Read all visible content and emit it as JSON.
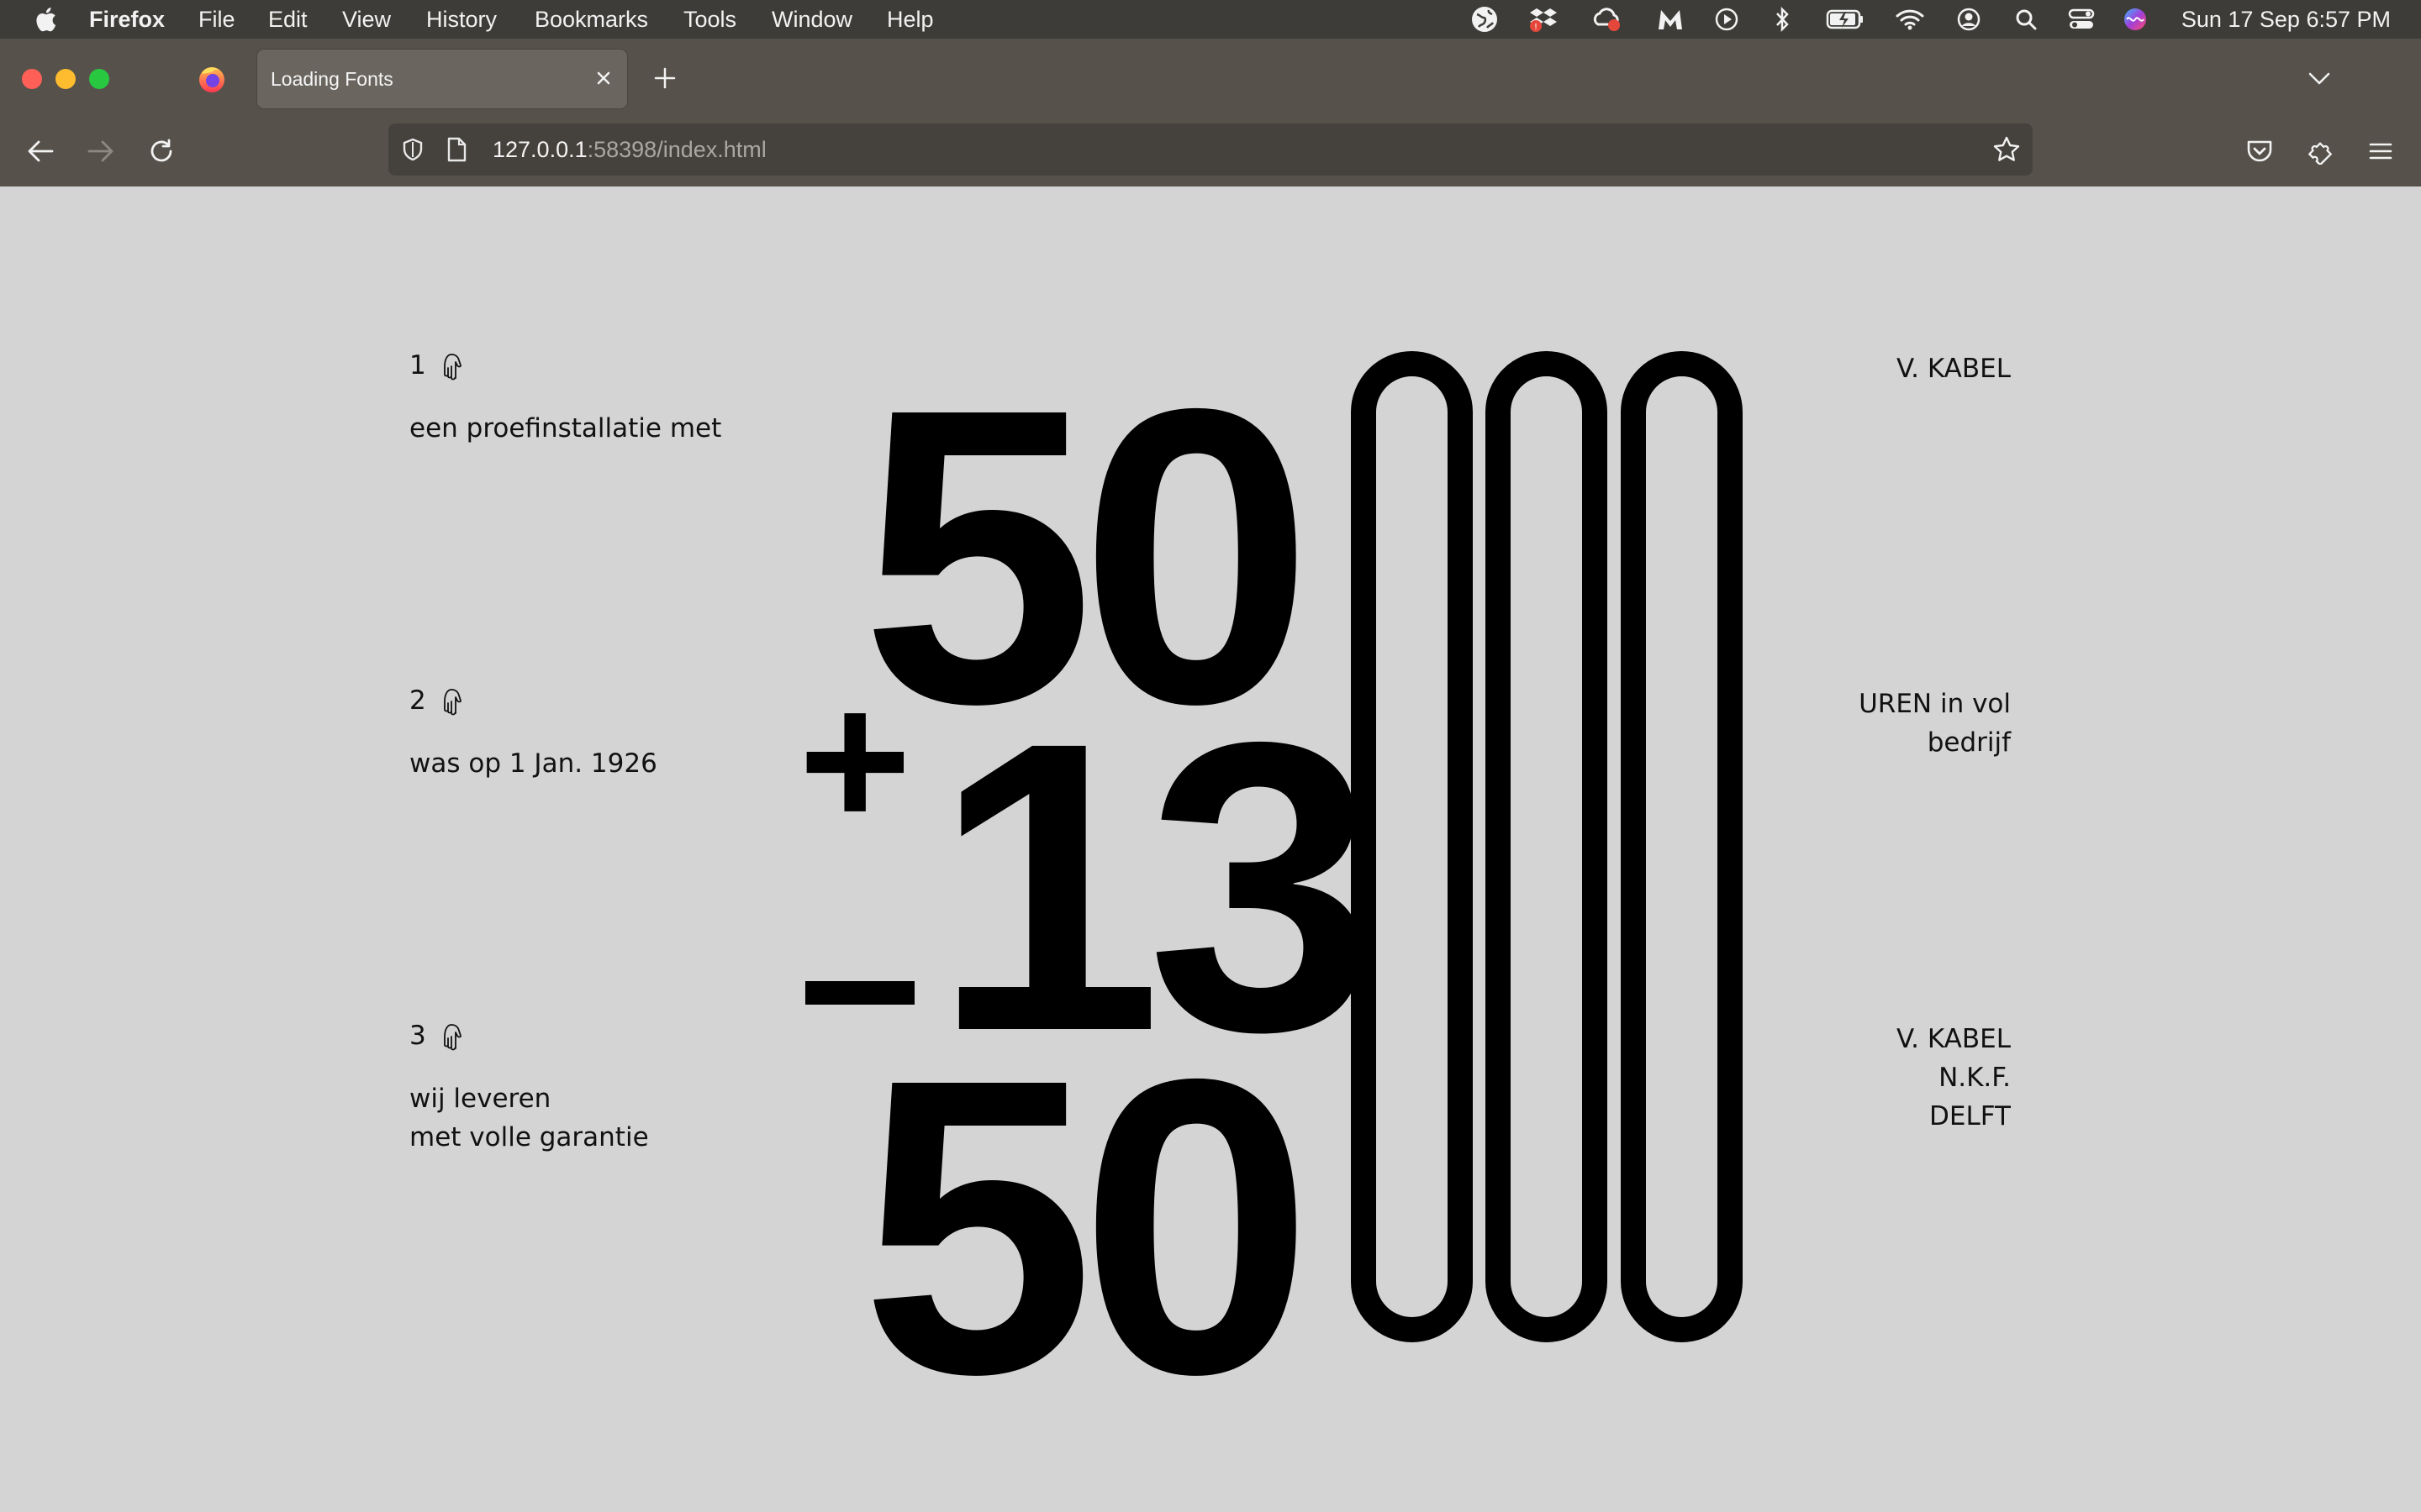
{
  "menubar": {
    "app_name": "Firefox",
    "items": [
      "File",
      "Edit",
      "View",
      "History",
      "Bookmarks",
      "Tools",
      "Window",
      "Help"
    ],
    "clock": "Sun 17 Sep  6:57 PM"
  },
  "browser": {
    "tab_title": "Loading Fonts",
    "url_host": "127.0.0.1",
    "url_rest": ":58398/index.html"
  },
  "page": {
    "rows": [
      {
        "number": "1",
        "left_lines": [
          "een proefinstallatie met"
        ],
        "right_lines": [
          "V. KABEL"
        ]
      },
      {
        "number": "2",
        "left_lines": [
          "was op 1 Jan. 1926"
        ],
        "right_lines": [
          "UREN in vol",
          "bedrijf"
        ]
      },
      {
        "number": "3",
        "left_lines": [
          "wij leveren",
          "met volle garantie"
        ],
        "right_lines": [
          "V. KABEL",
          "N.K.F.",
          "DELFT"
        ]
      }
    ],
    "big": {
      "top": "50",
      "middle": "13",
      "bottom": "50",
      "plus": "+",
      "minus": "−"
    }
  },
  "icons": [
    "apple-icon",
    "globe-icon",
    "dropbox-icon",
    "creative-cloud-icon",
    "malwarebytes-icon",
    "play-icon",
    "bluetooth-icon",
    "battery-icon",
    "wifi-icon",
    "user-icon",
    "search-icon",
    "control-center-icon",
    "siri-icon",
    "pointing-hand-icon"
  ]
}
